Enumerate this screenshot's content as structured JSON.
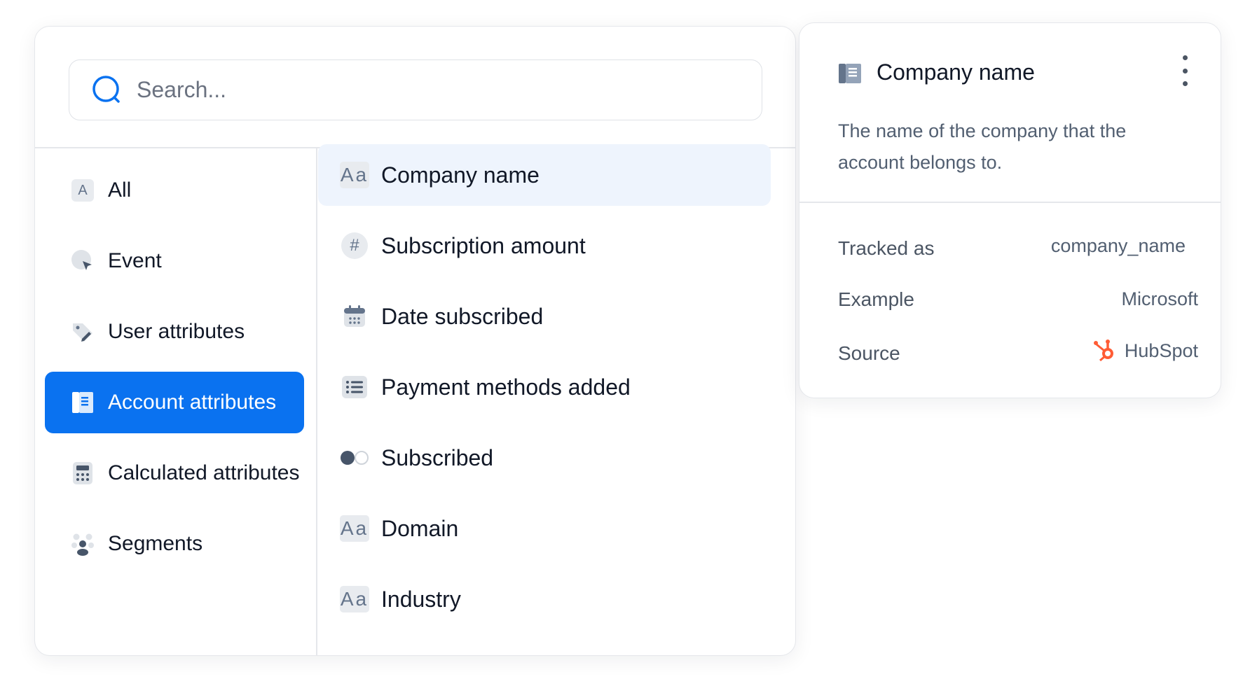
{
  "search": {
    "placeholder": "Search..."
  },
  "categories": [
    {
      "label": "All",
      "icon": "letter-a-icon"
    },
    {
      "label": "Event",
      "icon": "cursor-click-icon"
    },
    {
      "label": "User attributes",
      "icon": "user-tag-icon"
    },
    {
      "label": "Account attributes",
      "icon": "building-icon",
      "active": true
    },
    {
      "label": "Calculated attributes",
      "icon": "calculator-icon"
    },
    {
      "label": "Segments",
      "icon": "people-group-icon"
    }
  ],
  "attributes": [
    {
      "label": "Company name",
      "icon": "text-aa-icon",
      "active": true
    },
    {
      "label": "Subscription amount",
      "icon": "hash-icon"
    },
    {
      "label": "Date subscribed",
      "icon": "calendar-icon"
    },
    {
      "label": "Payment methods added",
      "icon": "list-icon"
    },
    {
      "label": "Subscribed",
      "icon": "toggle-icon"
    },
    {
      "label": "Domain",
      "icon": "text-aa-icon"
    },
    {
      "label": "Industry",
      "icon": "text-aa-icon"
    }
  ],
  "aa_glyph": "Aa",
  "hash_glyph": "#",
  "category_all_glyph": "A",
  "detail": {
    "title": "Company name",
    "description": "The name of the company that the account belongs to.",
    "properties": {
      "tracked_as_label": "Tracked as",
      "tracked_as_value": "company_name",
      "example_label": "Example",
      "example_value": "Microsoft",
      "source_label": "Source",
      "source_value": "HubSpot"
    }
  },
  "colors": {
    "accent": "#0a72f0",
    "hubspot": "#ff5c35",
    "icon_gray": "#64748b"
  }
}
